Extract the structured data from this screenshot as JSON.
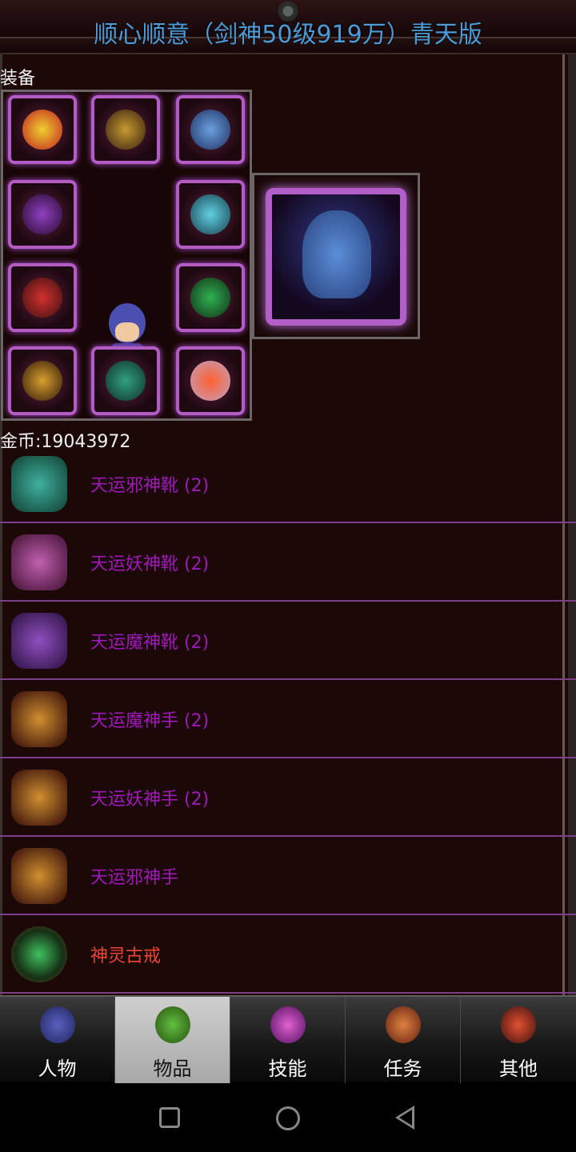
{
  "title": "顺心顺意（剑神50级919万）青天版",
  "equipment": {
    "section_label": "装备",
    "slots": [
      {
        "icon": "helmet-crown-icon"
      },
      {
        "icon": "dragon-necklace-icon"
      },
      {
        "icon": "demon-armor-icon"
      },
      {
        "icon": "sword-left-icon"
      },
      {
        "icon": "sword-right-icon"
      },
      {
        "icon": "bracelet-red-icon"
      },
      {
        "icon": "ring-green-icon"
      },
      {
        "icon": "glove-gold-icon"
      },
      {
        "icon": "boots-green-icon"
      },
      {
        "icon": "spirit-pet-icon"
      }
    ],
    "relic_icon": "winged-beast-icon"
  },
  "gold": {
    "text": "金币:19043972"
  },
  "items": [
    {
      "name": "天运邪神靴 (2)",
      "icon": "green-boots-icon",
      "color": "#9e1ab8"
    },
    {
      "name": "天运妖神靴 (2)",
      "icon": "pink-boots-icon",
      "color": "#9e1ab8"
    },
    {
      "name": "天运魔神靴 (2)",
      "icon": "purple-boots-icon",
      "color": "#9e1ab8"
    },
    {
      "name": "天运魔神手 (2)",
      "icon": "gold-glove-icon",
      "color": "#9e1ab8"
    },
    {
      "name": "天运妖神手 (2)",
      "icon": "gold-glove-icon",
      "color": "#9e1ab8"
    },
    {
      "name": "天运邪神手",
      "icon": "gold-glove-icon",
      "color": "#9e1ab8"
    },
    {
      "name": "神灵古戒",
      "icon": "jade-ring-icon",
      "color": "#ee4535"
    }
  ],
  "tabs": [
    {
      "label": "人物",
      "icon": "character-icon",
      "active": false
    },
    {
      "label": "物品",
      "icon": "potion-icon",
      "active": true
    },
    {
      "label": "技能",
      "icon": "skill-orb-icon",
      "active": false
    },
    {
      "label": "任务",
      "icon": "quest-flag-icon",
      "active": false
    },
    {
      "label": "其他",
      "icon": "other-sword-icon",
      "active": false
    }
  ]
}
